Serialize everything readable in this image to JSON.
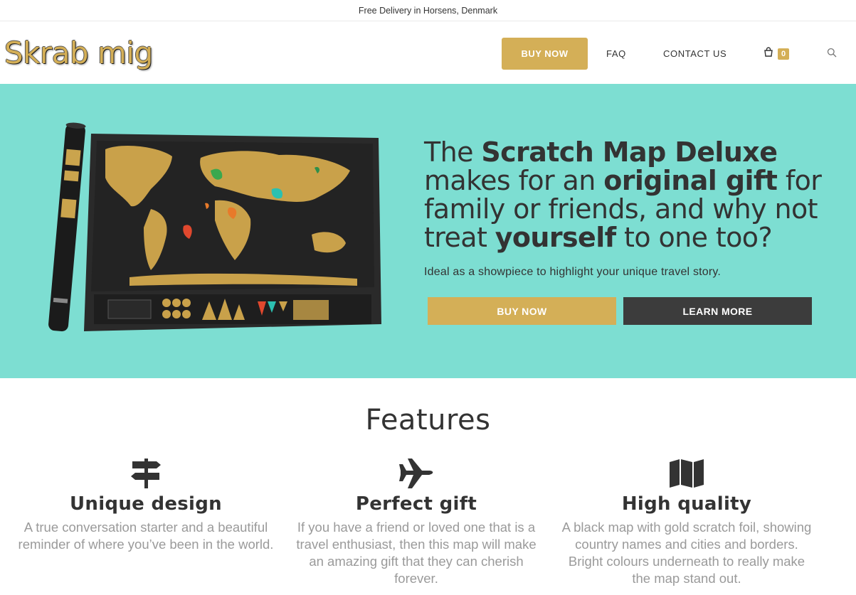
{
  "topbar": {
    "text": "Free Delivery in Horsens, Denmark"
  },
  "header": {
    "logo": "Skrab mig",
    "nav": {
      "buy_now": "BUY NOW",
      "faq": "FAQ",
      "contact": "CONTACT US"
    },
    "cart_count": "0"
  },
  "hero": {
    "title_parts": [
      "The ",
      "Scratch Map Deluxe",
      " makes for an ",
      "original gift",
      " for family or friends, and why not treat ",
      "yourself",
      " to one too?"
    ],
    "subtitle": "Ideal as a showpiece to highlight your unique travel story.",
    "buy_label": "BUY NOW",
    "learn_label": "LEARN MORE"
  },
  "features": {
    "title": "Features",
    "items": [
      {
        "icon": "signpost-icon",
        "title": "Unique design",
        "text": "A true conversation starter and a beautiful reminder of where you’ve been in the world."
      },
      {
        "icon": "airplane-icon",
        "title": "Perfect gift",
        "text": "If you have a friend or loved one that is a travel enthusiast, then this map will make an amazing gift that they can cherish forever."
      },
      {
        "icon": "map-icon",
        "title": "High quality",
        "text": "A black map with gold scratch foil, showing country names and cities and borders. Bright colours underneath to really make the map stand out."
      }
    ]
  },
  "colors": {
    "accent": "#d4af57",
    "hero_bg": "#7dded2",
    "dark": "#3c3c3c"
  }
}
